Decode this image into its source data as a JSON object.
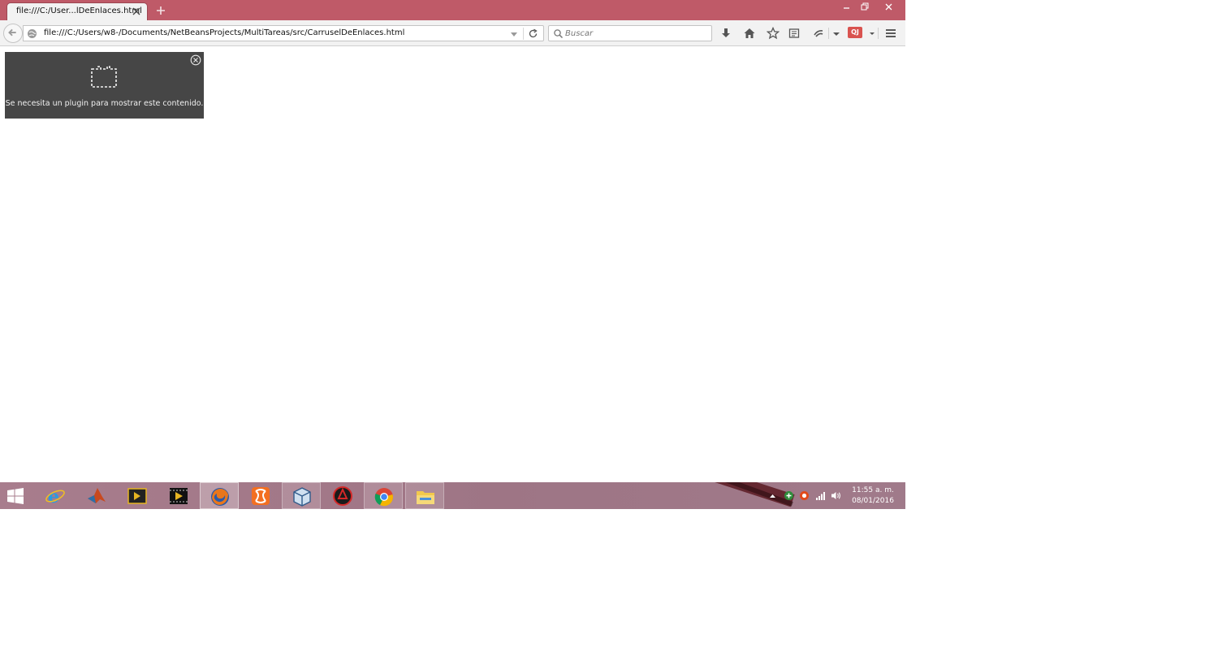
{
  "browser": {
    "tab": {
      "title": "file:///C:/User...lDeEnlaces.html"
    },
    "url": "file:///C:/Users/w8-/Documents/NetBeansProjects/MultiTareas/src/CarruselDeEnlaces.html",
    "search": {
      "placeholder": "Buscar"
    },
    "addon_badge": "QJ"
  },
  "page": {
    "plugin_message": "Se necesita un plugin para mostrar este contenido."
  },
  "taskbar": {
    "apps": [
      {
        "name": "internet-explorer"
      },
      {
        "name": "matlab"
      },
      {
        "name": "video-editor-15"
      },
      {
        "name": "video-editor"
      },
      {
        "name": "firefox",
        "state": "active"
      },
      {
        "name": "xampp"
      },
      {
        "name": "virtualbox",
        "state": "pinned"
      },
      {
        "name": "red-circle-app"
      },
      {
        "name": "chrome",
        "state": "pinned"
      },
      {
        "name": "file-explorer",
        "state": "pinned"
      }
    ],
    "clock": {
      "time": "11:55 a. m.",
      "date": "08/01/2016"
    }
  },
  "colors": {
    "titlebar": "#bf5a68",
    "toolbar": "#f2f2f2",
    "plugin_bg": "#464646",
    "taskbar": "#a07a8a"
  }
}
